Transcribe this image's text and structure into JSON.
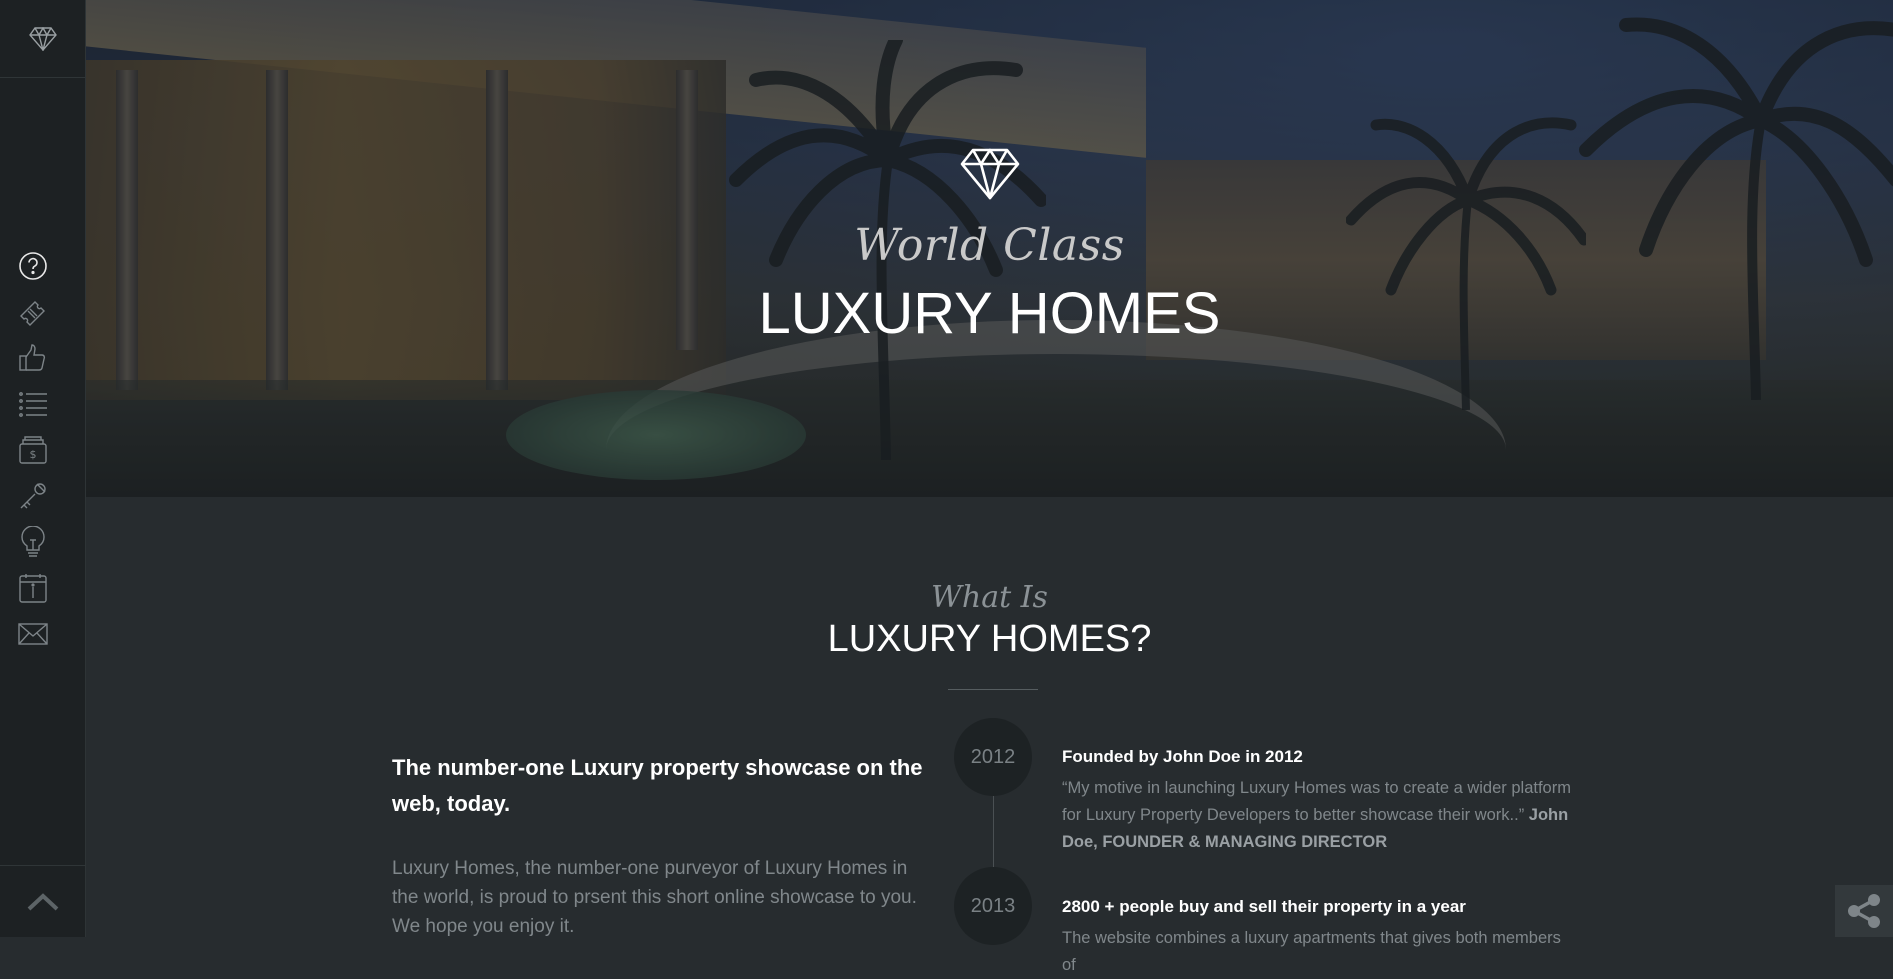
{
  "sidebar": {
    "logo_icon": "diamond-icon",
    "items": [
      {
        "icon": "question-icon"
      },
      {
        "icon": "ticket-icon"
      },
      {
        "icon": "thumbs-up-icon"
      },
      {
        "icon": "list-icon"
      },
      {
        "icon": "money-box-icon"
      },
      {
        "icon": "key-icon"
      },
      {
        "icon": "lightbulb-icon"
      },
      {
        "icon": "info-calendar-icon"
      },
      {
        "icon": "envelope-icon"
      }
    ],
    "to_top_icon": "chevron-up-icon"
  },
  "hero": {
    "subtitle": "World Class",
    "title": "LUXURY HOMES"
  },
  "about": {
    "kicker": "What Is",
    "heading": "LUXURY HOMES?",
    "lead": "The number-one Luxury property showcase on the web, today.",
    "body": "Luxury Homes, the number-one purveyor of Luxury Homes in the world, is proud to prsent this short online showcase to you. We hope you enjoy it."
  },
  "timeline": [
    {
      "year": "2012",
      "title": "Founded by John Doe in 2012",
      "text": "“My motive in launching Luxury Homes was to create a wider platform for Luxury Property Developers to better showcase their work..”",
      "author": "John Doe, FOUNDER & MANAGING DIRECTOR"
    },
    {
      "year": "2013",
      "title": "2800 + people buy and sell their property in a year",
      "text": "The website combines a luxury apartments that gives both members of"
    }
  ],
  "share_icon": "share-icon",
  "colors": {
    "sidebar_bg": "#1d2123",
    "section_bg": "#272c2f",
    "muted_text": "#80878b"
  }
}
